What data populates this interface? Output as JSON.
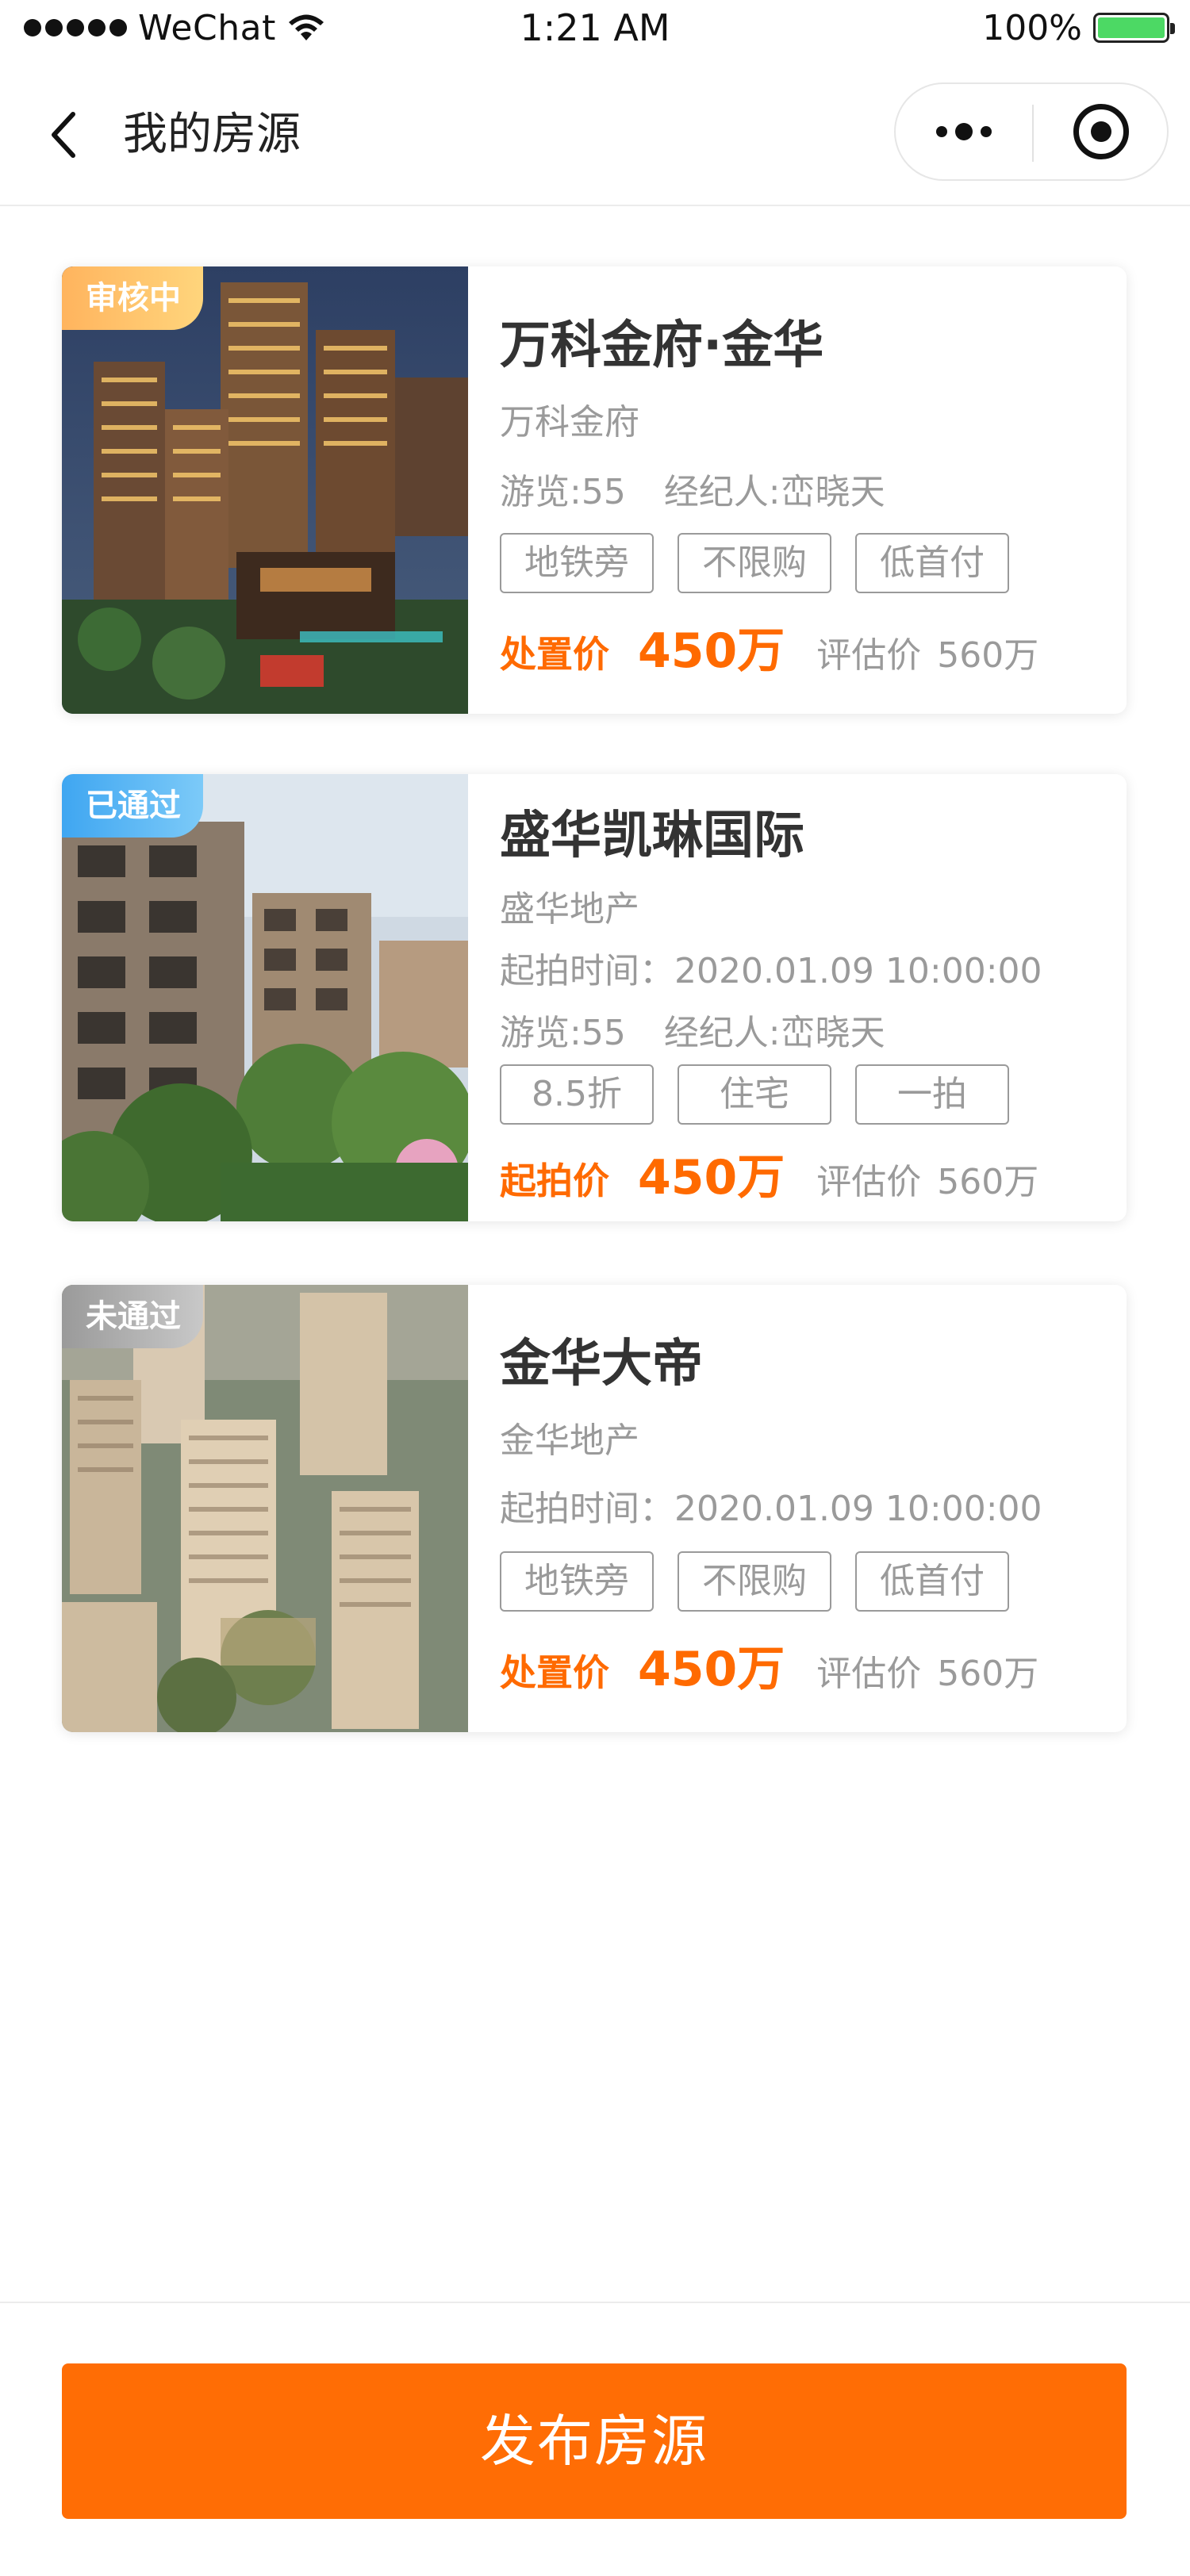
{
  "status_bar": {
    "carrier": "WeChat",
    "time": "1:21 AM",
    "battery": "100%"
  },
  "nav": {
    "title": "我的房源"
  },
  "listings": [
    {
      "status": "审核中",
      "title": "万科金府·金华",
      "developer": "万科金府",
      "start_time": "",
      "views": "游览:55",
      "agent": "经纪人:峦晓天",
      "tags": [
        "地铁旁",
        "不限购",
        "低首付"
      ],
      "price_label": "处置价",
      "price": "450万",
      "estimate_label": "评估价",
      "estimate": "560万"
    },
    {
      "status": "已通过",
      "title": "盛华凯琳国际",
      "developer": "盛华地产",
      "start_time": "起拍时间：2020.01.09 10:00:00",
      "views": "游览:55",
      "agent": "经纪人:峦晓天",
      "tags": [
        "8.5折",
        "住宅",
        "一拍"
      ],
      "price_label": "起拍价",
      "price": "450万",
      "estimate_label": "评估价",
      "estimate": "560万"
    },
    {
      "status": "未通过",
      "title": "金华大帝",
      "developer": "金华地产",
      "start_time": "起拍时间：2020.01.09 10:00:00",
      "views": "",
      "agent": "",
      "tags": [
        "地铁旁",
        "不限购",
        "低首付"
      ],
      "price_label": "处置价",
      "price": "450万",
      "estimate_label": "评估价",
      "estimate": "560万"
    }
  ],
  "bottom": {
    "publish_label": "发布房源"
  },
  "colors": {
    "accent": "#ff6d05",
    "price": "#ff6a00",
    "muted": "#9a9a9a",
    "badge_pending": "#ffb45e",
    "badge_passed": "#3fa6f1",
    "badge_rejected": "#9a9a9a"
  },
  "icons": [
    "signal-icon",
    "wifi-icon",
    "battery-icon",
    "back-arrow-icon",
    "more-dots-icon",
    "close-target-icon"
  ]
}
